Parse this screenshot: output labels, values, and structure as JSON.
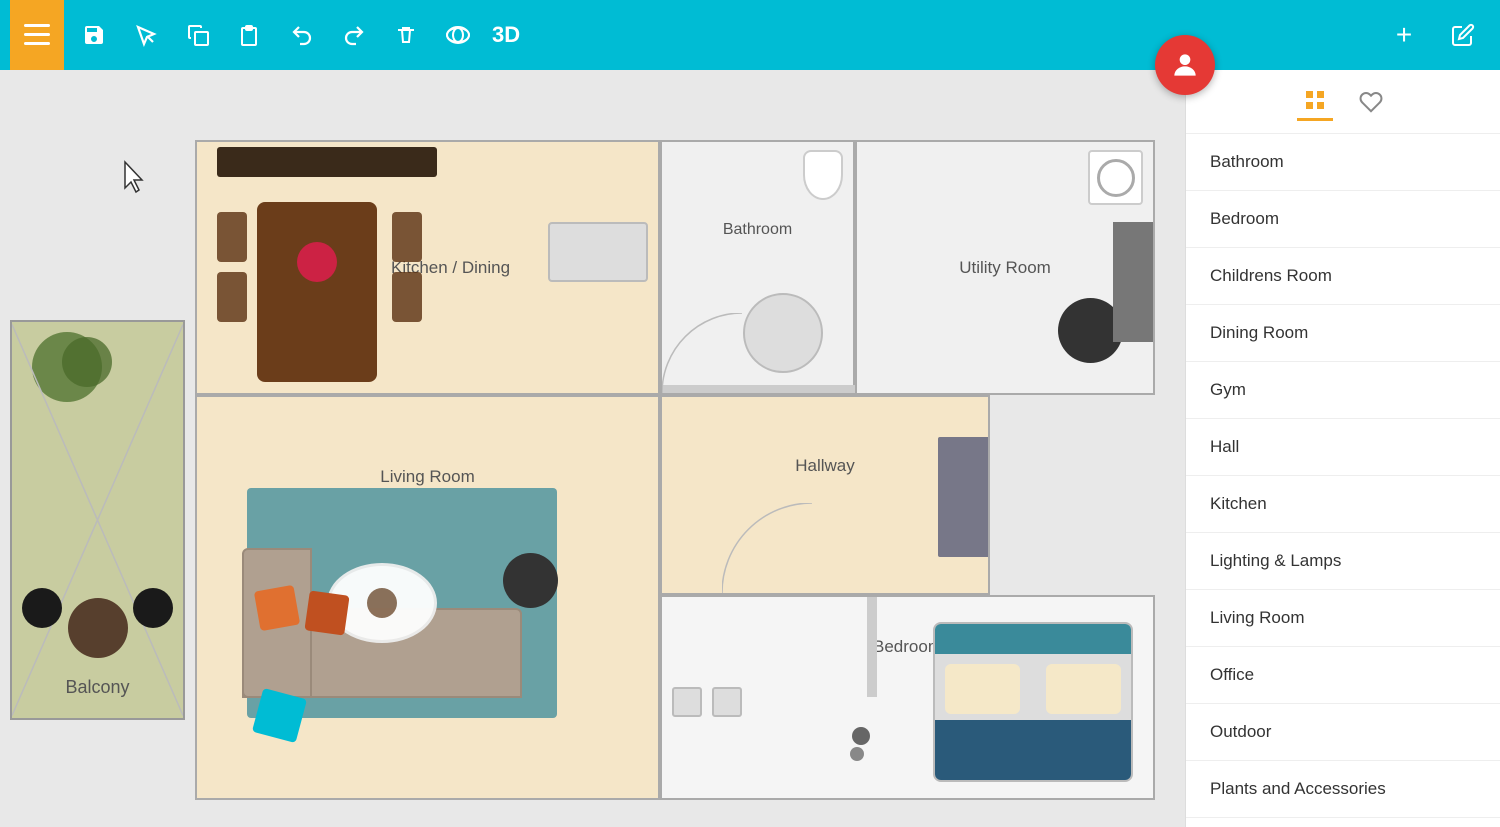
{
  "toolbar": {
    "menu_label": "☰",
    "tool_3d": "3D",
    "tools": [
      {
        "name": "save",
        "icon": "💾",
        "label": "save-tool"
      },
      {
        "name": "select",
        "icon": "⇌",
        "label": "select-tool"
      },
      {
        "name": "copy",
        "icon": "⧉",
        "label": "copy-tool"
      },
      {
        "name": "paste",
        "icon": "📋",
        "label": "paste-tool"
      },
      {
        "name": "undo",
        "icon": "↩",
        "label": "undo-tool"
      },
      {
        "name": "redo",
        "icon": "↪",
        "label": "redo-tool"
      },
      {
        "name": "delete",
        "icon": "🗑",
        "label": "delete-tool"
      },
      {
        "name": "360",
        "icon": "360°",
        "label": "360-tool"
      }
    ]
  },
  "panel": {
    "grid_tab_icon": "⊞",
    "heart_tab_icon": "♡",
    "plus_icon": "+",
    "edit_icon": "✎",
    "categories": [
      {
        "id": "bathroom",
        "label": "Bathroom"
      },
      {
        "id": "bedroom",
        "label": "Bedroom"
      },
      {
        "id": "childrens-room",
        "label": "Childrens Room"
      },
      {
        "id": "dining-room",
        "label": "Dining Room"
      },
      {
        "id": "gym",
        "label": "Gym"
      },
      {
        "id": "hall",
        "label": "Hall"
      },
      {
        "id": "kitchen",
        "label": "Kitchen"
      },
      {
        "id": "lighting-lamps",
        "label": "Lighting & Lamps"
      },
      {
        "id": "living-room",
        "label": "Living Room"
      },
      {
        "id": "office",
        "label": "Office"
      },
      {
        "id": "outdoor",
        "label": "Outdoor"
      },
      {
        "id": "plants-accessories",
        "label": "Plants and Accessories"
      }
    ]
  },
  "rooms": {
    "kitchen_dining": "Kitchen / Dining",
    "bathroom": "Bathroom",
    "utility": "Utility Room",
    "living": "Living Room",
    "hallway": "Hallway",
    "bedroom": "Bedroom",
    "balcony": "Balcony"
  },
  "colors": {
    "toolbar_bg": "#00bcd4",
    "menu_btn": "#f5a623",
    "avatar_bg": "#e53935",
    "room_warm": "#f5e6c8",
    "room_cool": "#f0f0f0",
    "balcony_bg": "#c8cca0",
    "active_tab": "#f5a623"
  }
}
